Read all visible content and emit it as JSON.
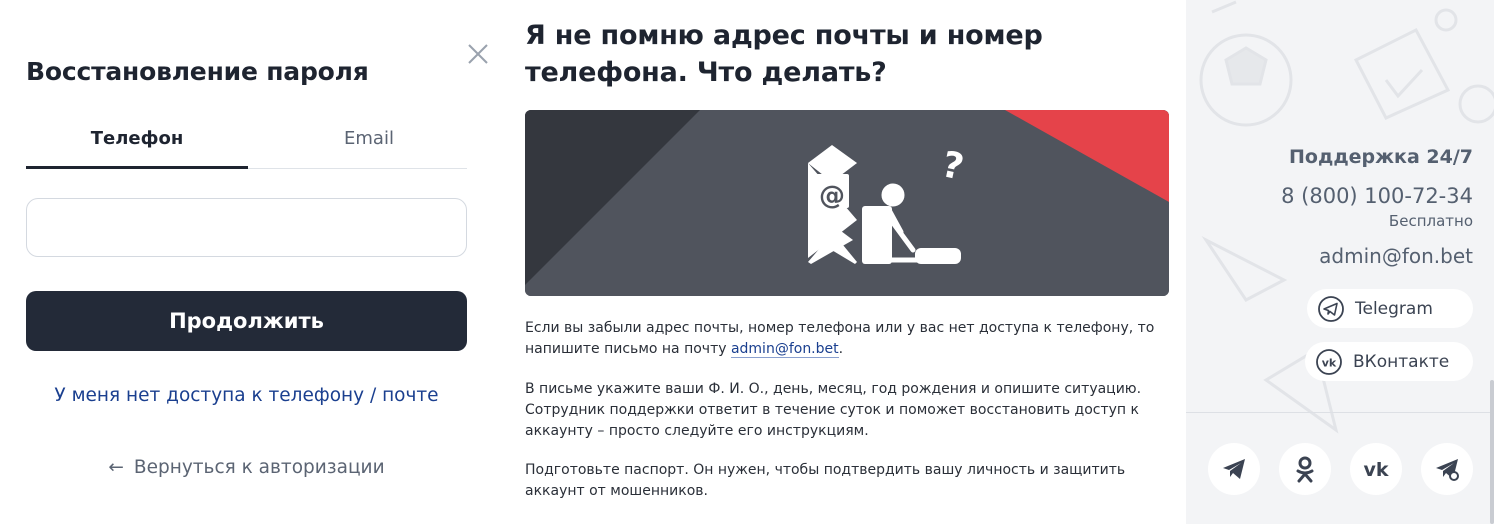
{
  "recovery": {
    "title": "Восстановление пароля",
    "tabs": [
      {
        "label": "Телефон",
        "active": true
      },
      {
        "label": "Email",
        "active": false
      }
    ],
    "phone_input": {
      "value": "",
      "placeholder": ""
    },
    "continue_label": "Продолжить",
    "no_access_label": "У меня нет доступа к телефону / почте",
    "back_label": "Вернуться к авторизации",
    "back_arrow": "←"
  },
  "help": {
    "title": "Я не помню адрес почты и номер телефона. Что делать?",
    "p1_before": "Если вы забыли адрес почты, номер телефона или у вас нет доступа к телефону, то напишите письмо на почту ",
    "p1_link": "admin@fon.bet",
    "p1_after": ".",
    "p2": "В письме укажите ваши Ф. И. О., день, месяц, год рождения и опишите ситуацию. Сотрудник поддержки ответит в течение суток и поможет восстановить доступ к аккаунту – просто следуйте его инструкциям.",
    "p3": "Подготовьте паспорт. Он нужен, чтобы подтвердить вашу личность и защитить аккаунт от мошенников."
  },
  "support": {
    "title": "Поддержка 24/7",
    "phone": "8 (800) 100-72-34",
    "phone_note": "Бесплатно",
    "email": "admin@fon.bet",
    "telegram_label": "Telegram",
    "vk_label": "ВКонтакте",
    "socials": [
      "telegram-icon",
      "odnoklassniki-icon",
      "vk-icon",
      "telegram-bot-icon"
    ]
  },
  "colors": {
    "primary_button": "#232a38",
    "link": "#1a3f8f",
    "banner_red": "#e5434a",
    "banner_dark": "#50545d"
  }
}
